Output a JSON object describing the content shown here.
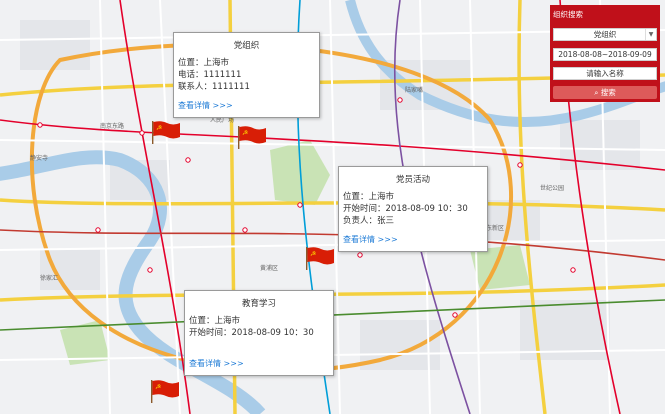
{
  "panel": {
    "title": "组织搜索",
    "type_select": "党组织",
    "date_range": "2018-08-08~2018-09-09",
    "name_input": "请输入名称",
    "search_label": "搜索",
    "search_icon": "search-icon"
  },
  "popups": {
    "org": {
      "title": "党组织",
      "location": "位置：上海市",
      "phone": "电话：1111111",
      "contact": "联系人：1111111",
      "link": "查看详情 >>>"
    },
    "activity": {
      "title": "党员活动",
      "location": "位置：上海市",
      "start_time": "开始时间：2018-08-09  10：30",
      "leader": "负责人：张三",
      "link": "查看详情 >>>"
    },
    "study": {
      "title": "教育学习",
      "location": "位置：上海市",
      "start_time": "开始时间：2018-08-09  10：30",
      "link": "查看详情 >>>"
    }
  },
  "map_labels": {
    "renmin_square": "人民广场",
    "nanjing_rd": "南京东路",
    "lujiazui": "陆家嘴",
    "century_park": "世纪公园",
    "xujiahui": "徐家汇",
    "jingan": "静安寺",
    "pudong": "浦东新区",
    "huangpu": "黄浦区"
  },
  "colors": {
    "panel_bg": "#c0101a",
    "link": "#1e7bd6",
    "flag_red": "#d81e06",
    "river": "#a9cce8",
    "park": "#c9e3b5"
  }
}
